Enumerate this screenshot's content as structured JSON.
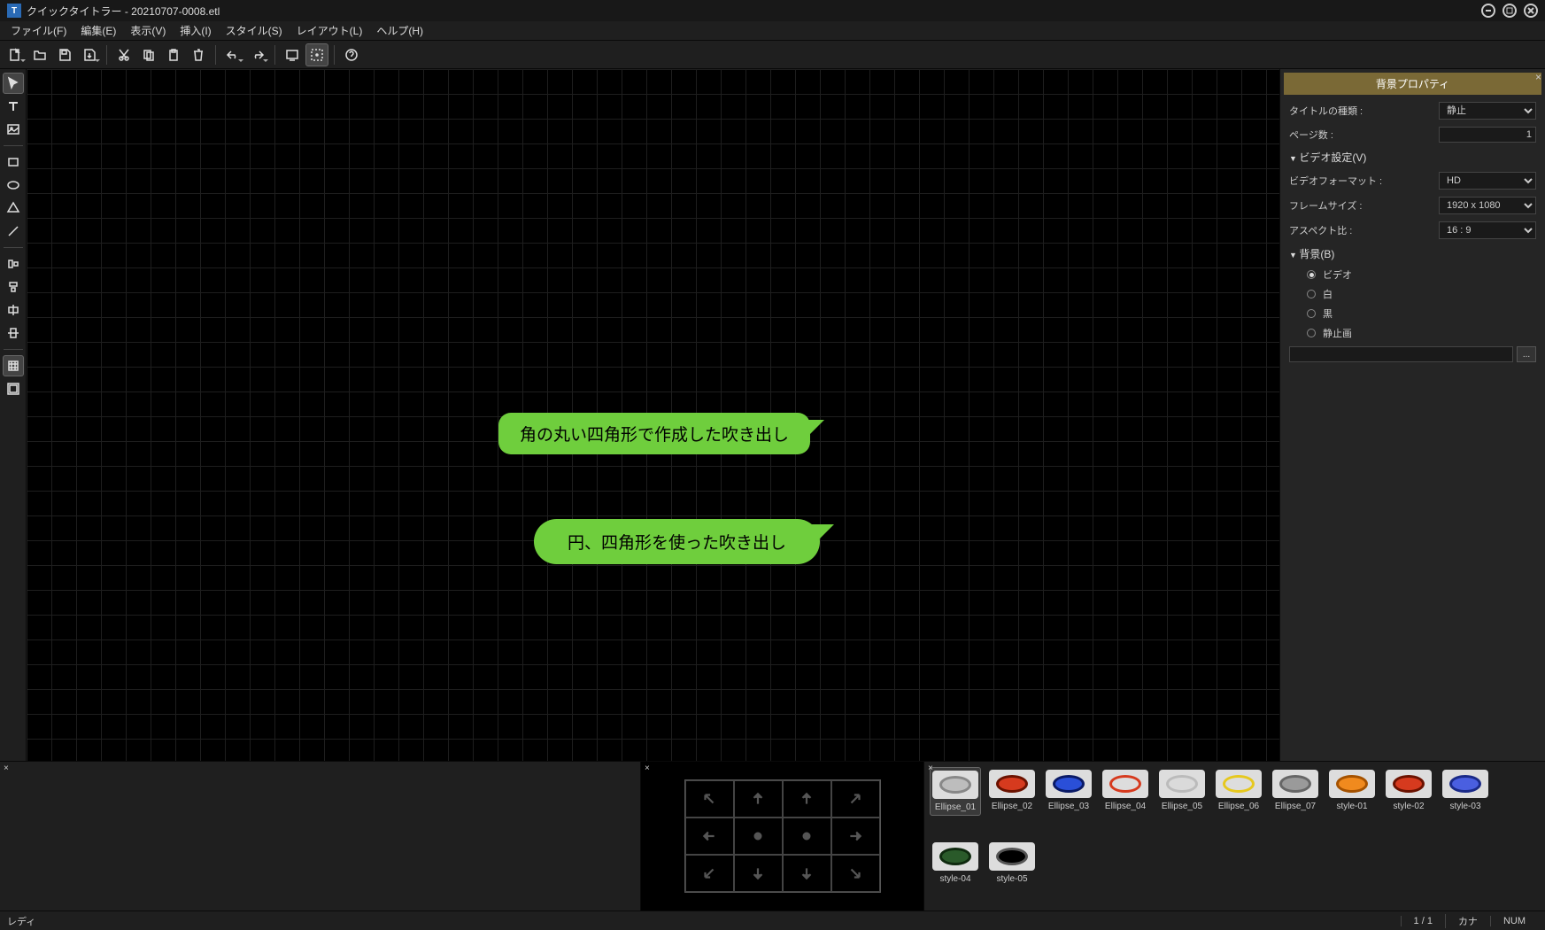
{
  "title": "クイックタイトラー - 20210707-0008.etl",
  "menu": [
    "ファイル(F)",
    "編集(E)",
    "表示(V)",
    "挿入(I)",
    "スタイル(S)",
    "レイアウト(L)",
    "ヘルプ(H)"
  ],
  "canvas": {
    "bubble1_text": "角の丸い四角形で作成した吹き出し",
    "bubble2_text": "円、四角形を使った吹き出し"
  },
  "right_panel": {
    "header": "背景プロパティ",
    "title_type_label": "タイトルの種類 :",
    "title_type_value": "静止",
    "page_count_label": "ページ数 :",
    "page_count_value": "1",
    "video_section": "ビデオ設定(V)",
    "video_format_label": "ビデオフォーマット :",
    "video_format_value": "HD",
    "frame_size_label": "フレームサイズ :",
    "frame_size_value": "1920 x 1080",
    "aspect_label": "アスペクト比 :",
    "aspect_value": "16 : 9",
    "bg_section": "背景(B)",
    "bg_options": [
      "ビデオ",
      "白",
      "黒",
      "静止画"
    ],
    "bg_selected": 0,
    "browse": "..."
  },
  "styles": [
    {
      "name": "Ellipse_01",
      "fill": "#bdbdbd",
      "stroke": "#888"
    },
    {
      "name": "Ellipse_02",
      "fill": "#d63a1e",
      "stroke": "#6b1200"
    },
    {
      "name": "Ellipse_03",
      "fill": "#2a4fd8",
      "stroke": "#0a1a66"
    },
    {
      "name": "Ellipse_04",
      "fill": "transparent",
      "stroke": "#d63a1e"
    },
    {
      "name": "Ellipse_05",
      "fill": "#dadada",
      "stroke": "#bbb"
    },
    {
      "name": "Ellipse_06",
      "fill": "transparent",
      "stroke": "#e6c81e"
    },
    {
      "name": "Ellipse_07",
      "fill": "#9a9a9a",
      "stroke": "#666"
    },
    {
      "name": "style-01",
      "fill": "#f08a1e",
      "stroke": "#a55200"
    },
    {
      "name": "style-02",
      "fill": "#d63a1e",
      "stroke": "#6b1200"
    },
    {
      "name": "style-03",
      "fill": "#4a5fe0",
      "stroke": "#1a2a88"
    },
    {
      "name": "style-04",
      "fill": "#2a5a2a",
      "stroke": "#0f2a0f"
    },
    {
      "name": "style-05",
      "fill": "#000",
      "stroke": "#555"
    }
  ],
  "styles_selected": 0,
  "status": {
    "ready": "レディ",
    "page": "1 / 1",
    "ime": "カナ",
    "num": "NUM"
  }
}
